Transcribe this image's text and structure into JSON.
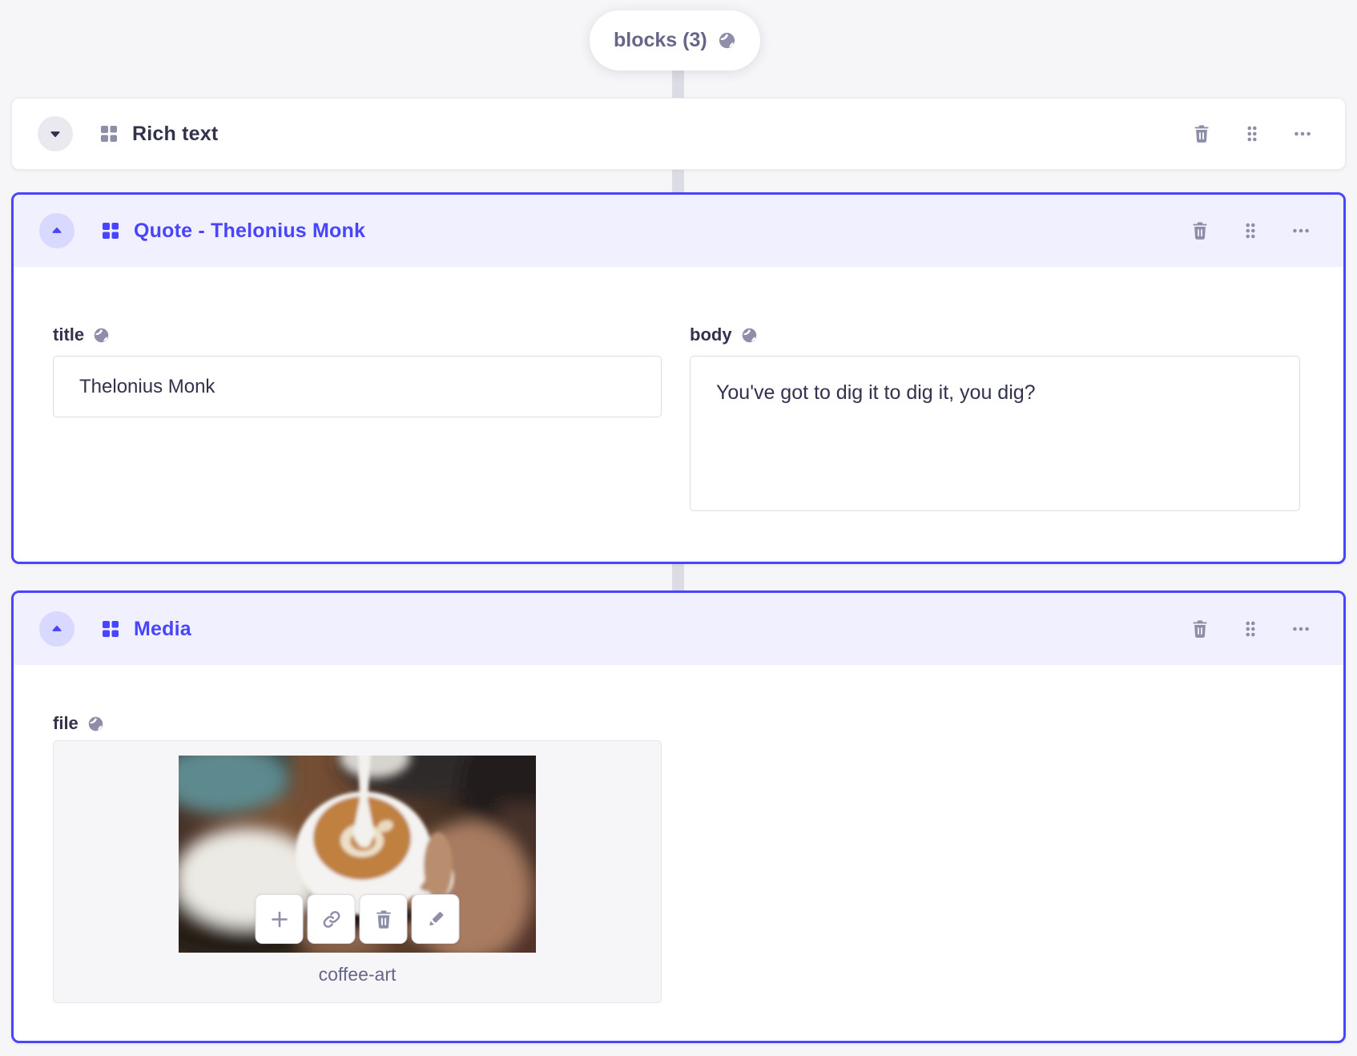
{
  "page": {
    "background": "#f6f6f9"
  },
  "colors": {
    "accent": "#4945ff",
    "accent_header_bg": "#f0f0ff",
    "accent_circle_bg": "#d9d8ff",
    "text_dark": "#32324d",
    "text_muted": "#666687",
    "icon_gray": "#8e8ea9",
    "field_border": "#dcdce4",
    "connector": "#dcdce4"
  },
  "pill": {
    "label": "blocks (3)",
    "icon": "globe-icon"
  },
  "header_action_icons": [
    "trash-icon",
    "drag-handle-icon",
    "more-options-icon"
  ],
  "blocks": [
    {
      "title": "Rich text",
      "state": "collapsed"
    },
    {
      "title": "Quote - Thelonius Monk",
      "state": "expanded",
      "fields": {
        "title": {
          "label": "title",
          "value": "Thelonius Monk"
        },
        "body": {
          "label": "body",
          "value": "You've got to dig it to dig it, you dig?"
        }
      }
    },
    {
      "title": "Media",
      "state": "expanded",
      "fields": {
        "file": {
          "label": "file",
          "filename": "coffee-art",
          "action_icons": [
            "plus-icon",
            "link-icon",
            "trash-icon",
            "pencil-icon"
          ]
        }
      }
    }
  ]
}
